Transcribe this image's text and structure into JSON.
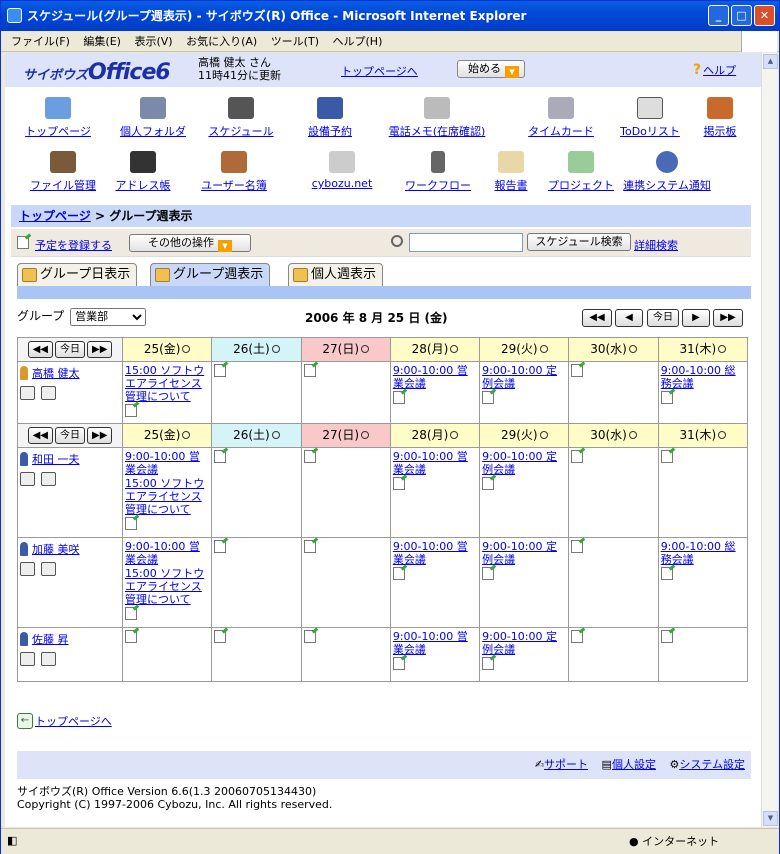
{
  "window": {
    "title": "スケジュール(グループ週表示) - サイボウズ(R) Office - Microsoft Internet Explorer"
  },
  "menu": [
    "ファイル(F)",
    "編集(E)",
    "表示(V)",
    "お気に入り(A)",
    "ツール(T)",
    "ヘルプ(H)"
  ],
  "header": {
    "logo_small": "サイボウズ",
    "logo_big": "Office6",
    "user_name": "高橋 健太 さん",
    "updated": "11時41分に更新",
    "top_link": "トップページへ",
    "start_label": "始める",
    "help_label": "ヘルプ"
  },
  "apps_row1": [
    "トップページ",
    "個人フォルダ",
    "スケジュール",
    "設備予約",
    "電話メモ(在席確認)",
    "タイムカード",
    "ToDoリスト",
    "掲示板"
  ],
  "apps_row2": [
    "ファイル管理",
    "アドレス帳",
    "ユーザー名簿",
    "cybozu.net",
    "ワークフロー",
    "報告書",
    "プロジェクト",
    "連携システム通知"
  ],
  "breadcrumb": {
    "top": "トップページ",
    "sep": " > ",
    "current": "グループ週表示"
  },
  "toolbar": {
    "register": "予定を登録する",
    "other_ops": "その他の操作",
    "search_btn": "スケジュール検索",
    "detail_search": "詳細検索",
    "search_value": ""
  },
  "tabs": [
    "グループ日表示",
    "グループ週表示",
    "個人週表示"
  ],
  "group": {
    "label": "グループ",
    "selected": "営業部"
  },
  "date_title": "2006 年 8 月 25 日 (金)",
  "nav": {
    "prev2": "◀◀",
    "prev": "◀",
    "today": "今日",
    "next": "▶",
    "next2": "▶▶"
  },
  "days": [
    "25(金)",
    "26(土)",
    "27(日)",
    "28(月)",
    "29(火)",
    "30(水)",
    "31(木)"
  ],
  "users": [
    {
      "name": "高橋 健太",
      "events": [
        [
          "15:00 ソフトウエアライセンス管理について"
        ],
        [],
        [],
        [
          "9:00-10:00 営業会議"
        ],
        [
          "9:00-10:00 定例会議"
        ],
        [],
        [
          "9:00-10:00 総務会議"
        ]
      ]
    },
    {
      "name": "和田 一夫",
      "events": [
        [
          "9:00-10:00 営業会議",
          "15:00 ソフトウエアライセンス管理について"
        ],
        [],
        [],
        [
          "9:00-10:00 営業会議"
        ],
        [
          "9:00-10:00 定例会議"
        ],
        [],
        []
      ]
    },
    {
      "name": "加藤 美咲",
      "events": [
        [
          "9:00-10:00 営業会議",
          "15:00 ソフトウエアライセンス管理について"
        ],
        [],
        [],
        [
          "9:00-10:00 営業会議"
        ],
        [
          "9:00-10:00 定例会議"
        ],
        [],
        [
          "9:00-10:00 総務会議"
        ]
      ]
    },
    {
      "name": "佐藤 昇",
      "events": [
        [],
        [],
        [],
        [
          "9:00-10:00 営業会議"
        ],
        [
          "9:00-10:00 定例会議"
        ],
        [],
        []
      ]
    }
  ],
  "footer": {
    "back_top": "トップページへ",
    "support": "サポート",
    "personal": "個人設定",
    "system": "システム設定",
    "version": "サイボウズ(R) Office Version 6.6(1.3 20060705134430)",
    "copyright": "Copyright (C) 1997-2006 Cybozu, Inc. All rights reserved."
  },
  "status": {
    "zone": "インターネット"
  }
}
